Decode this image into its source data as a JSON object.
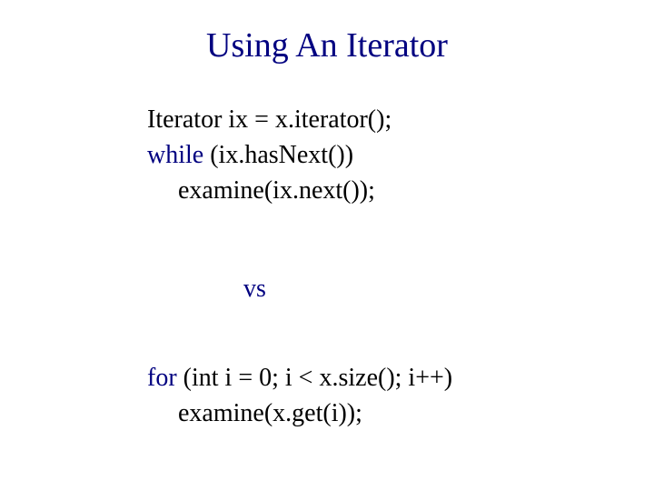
{
  "title": "Using An Iterator",
  "code_block_1": {
    "line1": "Iterator ix = x.iterator();",
    "line2_kw": "while",
    "line2_rest": " (ix.hasNext())",
    "line3": "examine(ix.next());"
  },
  "vs_label": "vs",
  "code_block_2": {
    "line1_kw": "for",
    "line1_rest": " (int i = 0; i < x.size(); i++)",
    "line2": "examine(x.get(i));"
  }
}
